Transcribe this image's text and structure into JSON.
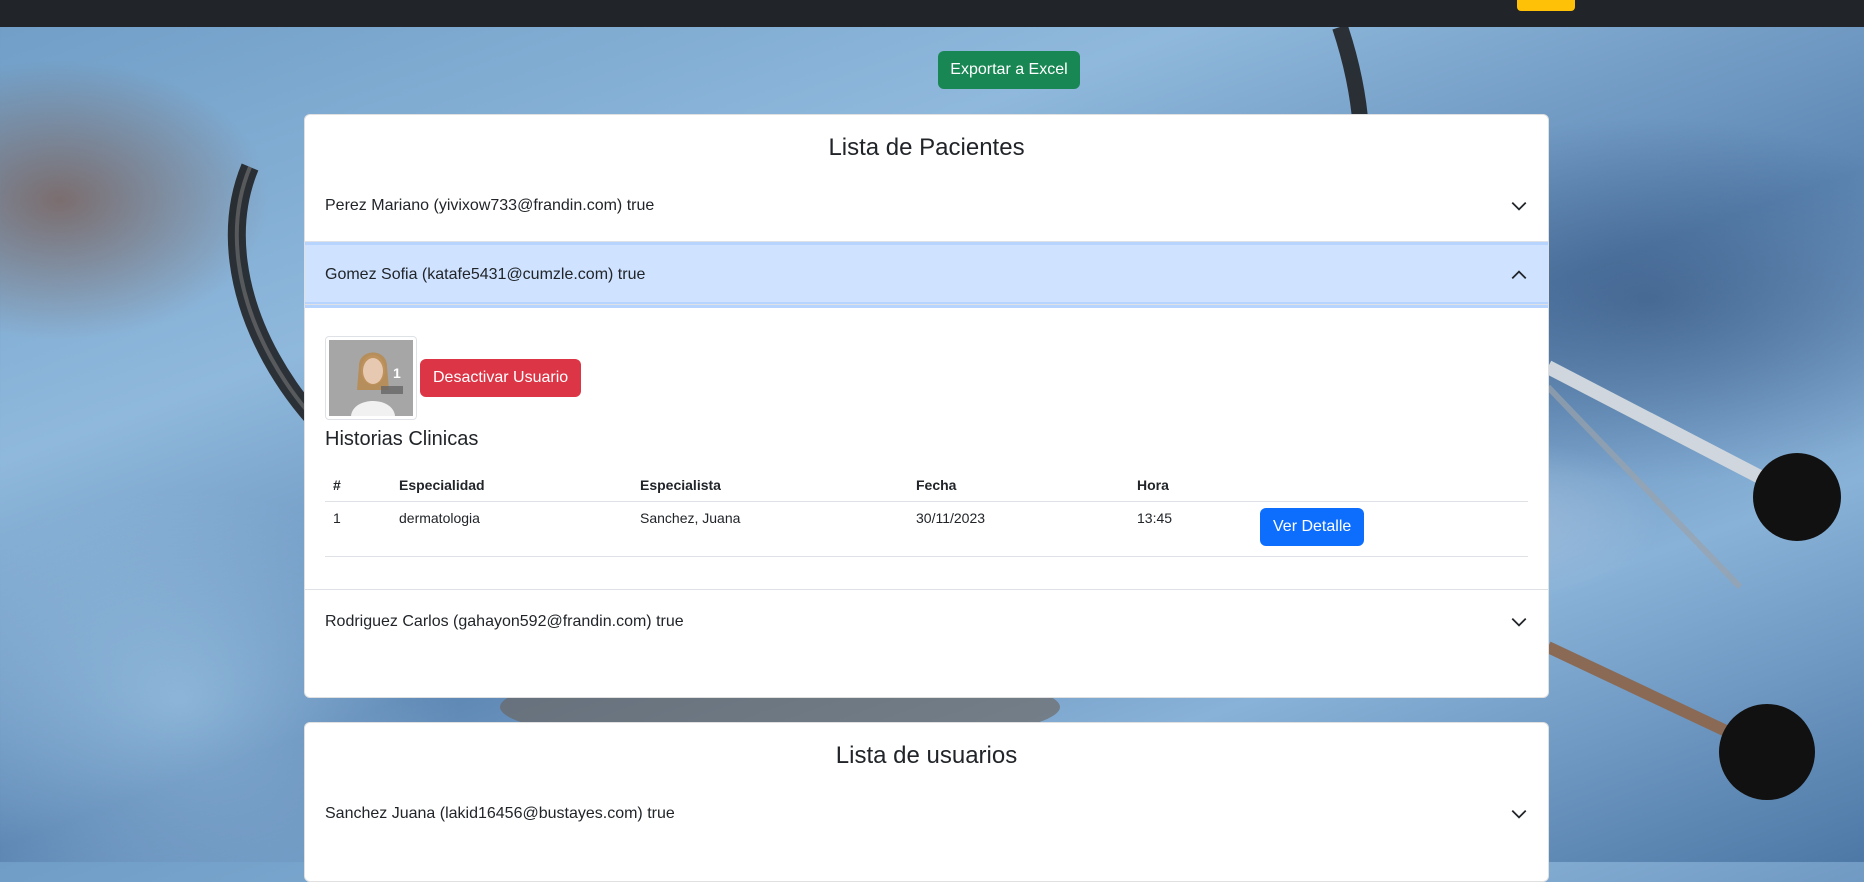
{
  "toolbar": {
    "export_label": "Exportar a Excel"
  },
  "patients": {
    "title": "Lista de Pacientes",
    "items": [
      {
        "label": "Perez Mariano (yivixow733@frandin.com) true"
      },
      {
        "label": "Gomez Sofia (katafe5431@cumzle.com) true",
        "deactivate_label": "Desactivar Usuario",
        "photo_badge": "1",
        "history_title": "Historias Clinicas",
        "columns": [
          "#",
          "Especialidad",
          "Especialista",
          "Fecha",
          "Hora"
        ],
        "rows": [
          {
            "num": "1",
            "especialidad": "dermatologia",
            "especialista": "Sanchez, Juana",
            "fecha": "30/11/2023",
            "hora": "13:45",
            "action": "Ver Detalle"
          }
        ]
      },
      {
        "label": "Rodriguez Carlos (gahayon592@frandin.com) true"
      }
    ]
  },
  "users": {
    "title": "Lista de usuarios",
    "items": [
      {
        "label": "Sanchez Juana (lakid16456@bustayes.com) true"
      }
    ]
  },
  "colors": {
    "export": "#198754",
    "deactivate": "#dc3545",
    "detail": "#0d6efd",
    "active_header": "#cfe2ff",
    "topbar": "#212529",
    "accent": "#ffc107"
  }
}
